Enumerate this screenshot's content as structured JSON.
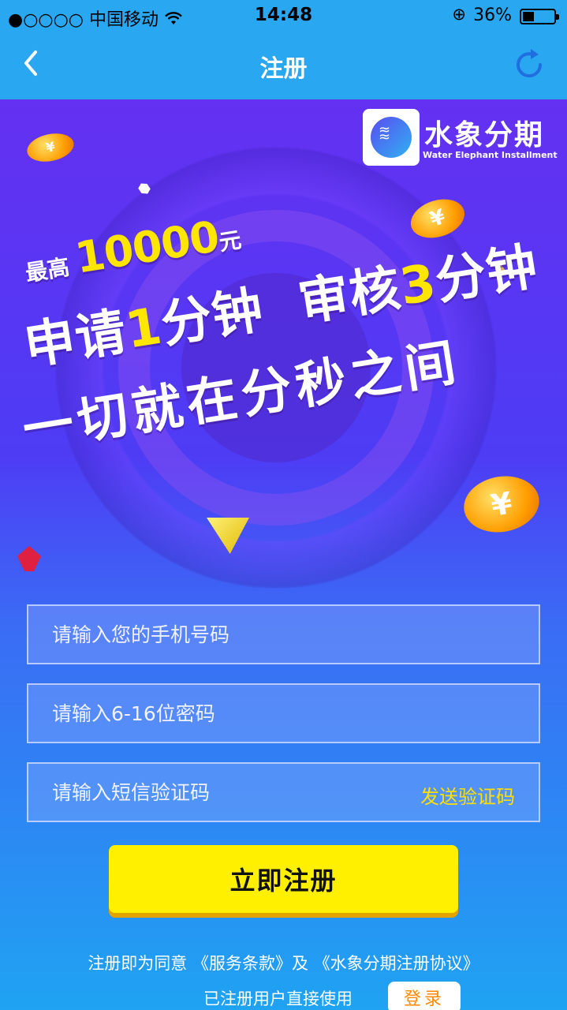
{
  "status_bar": {
    "signal": "●○○○○",
    "carrier": "中国移动",
    "wifi_icon": "wifi-icon",
    "time": "14:48",
    "lock_icon": "orientation-lock-icon",
    "battery_percent": "36%",
    "battery_level": 0.36
  },
  "nav": {
    "back_icon": "chevron-left-icon",
    "title": "注册",
    "refresh_icon": "refresh-icon"
  },
  "banner": {
    "brand_name": "水象分期",
    "brand_subtitle": "Water Elephant Installment",
    "coin_symbol": "¥",
    "max_label": "最高",
    "max_amount": "10000",
    "max_unit": "元",
    "line2": {
      "apply": "申请",
      "apply_num": "1",
      "apply_unit": "分钟",
      "review": "审核",
      "review_num": "3",
      "review_unit": "分钟"
    },
    "line3": "一切就在分秒之间"
  },
  "form": {
    "phone_placeholder": "请输入您的手机号码",
    "password_placeholder": "请输入6-16位密码",
    "sms_placeholder": "请输入短信验证码",
    "send_code_label": "发送验证码",
    "submit_label": "立即注册"
  },
  "footer": {
    "agree_prefix": "注册即为同意",
    "terms_link": "《服务条款》",
    "and": "及",
    "agreement_link": "《水象分期注册协议》",
    "existing_user": "已注册用户直接使用",
    "login_label": "登录"
  },
  "colors": {
    "nav_bg": "#2aa7f1",
    "accent_yellow": "#fff000",
    "send_code_color": "#ffe000",
    "login_text": "#ff8a00"
  }
}
